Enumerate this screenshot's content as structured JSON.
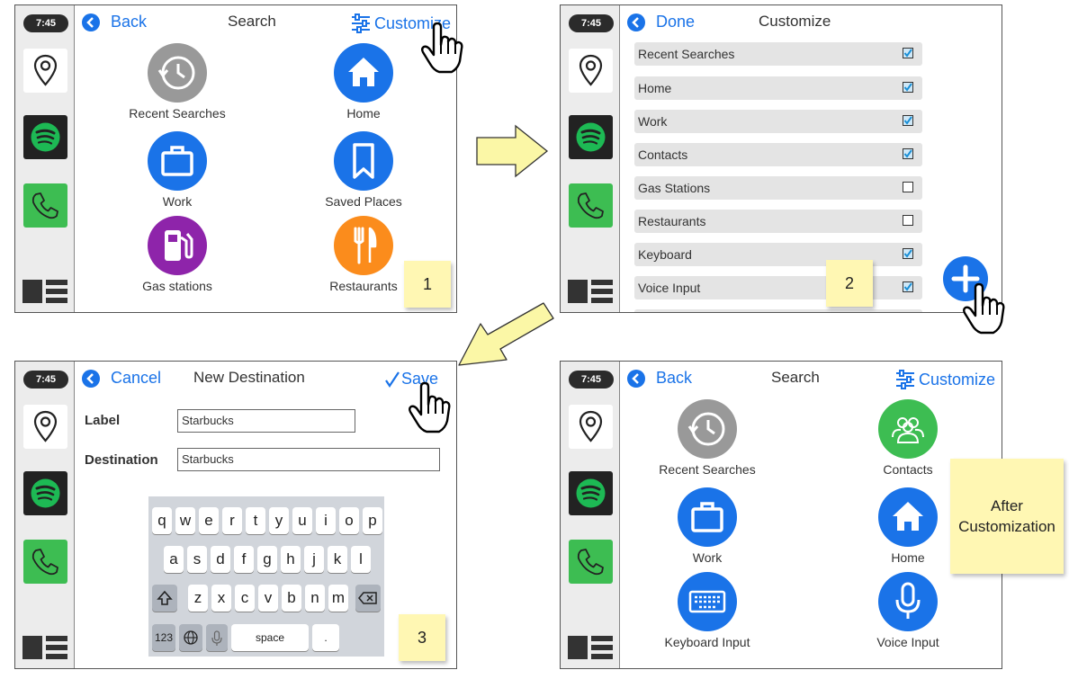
{
  "sidebar": {
    "clock": "7:45"
  },
  "panel1": {
    "back_label": "Back",
    "title": "Search",
    "customize_label": "Customize",
    "tiles": [
      "Recent Searches",
      "Home",
      "Work",
      "Saved Places",
      "Gas stations",
      "Restaurants"
    ],
    "note": "1"
  },
  "panel2": {
    "done_label": "Done",
    "title": "Customize",
    "items": [
      {
        "label": "Recent Searches",
        "checked": true
      },
      {
        "label": "Home",
        "checked": true
      },
      {
        "label": "Work",
        "checked": true
      },
      {
        "label": "Contacts",
        "checked": true
      },
      {
        "label": "Gas Stations",
        "checked": false
      },
      {
        "label": "Restaurants",
        "checked": false
      },
      {
        "label": "Keyboard",
        "checked": true
      },
      {
        "label": "Voice Input",
        "checked": true
      }
    ],
    "note": "2"
  },
  "panel3": {
    "cancel_label": "Cancel",
    "title": "New Destination",
    "save_label": "Save",
    "label_field": "Label",
    "label_value": "Starbucks",
    "destination_field": "Destination",
    "destination_value": "Starbucks",
    "keyboard": {
      "row1": [
        "q",
        "w",
        "e",
        "r",
        "t",
        "y",
        "u",
        "i",
        "o",
        "p"
      ],
      "row2": [
        "a",
        "s",
        "d",
        "f",
        "g",
        "h",
        "j",
        "k",
        "l"
      ],
      "row3": [
        "z",
        "x",
        "c",
        "v",
        "b",
        "n",
        "m"
      ],
      "num_key": "123",
      "space_key": "space",
      "period_key": "."
    },
    "note": "3"
  },
  "panel4": {
    "back_label": "Back",
    "title": "Search",
    "customize_label": "Customize",
    "tiles": [
      "Recent Searches",
      "Contacts",
      "Work",
      "Home",
      "Keyboard Input",
      "Voice Input"
    ],
    "note": "After Customization"
  },
  "colors": {
    "accent": "#1a73e8",
    "sticky": "#fff7b3",
    "arrow": "#fbf7a6"
  }
}
